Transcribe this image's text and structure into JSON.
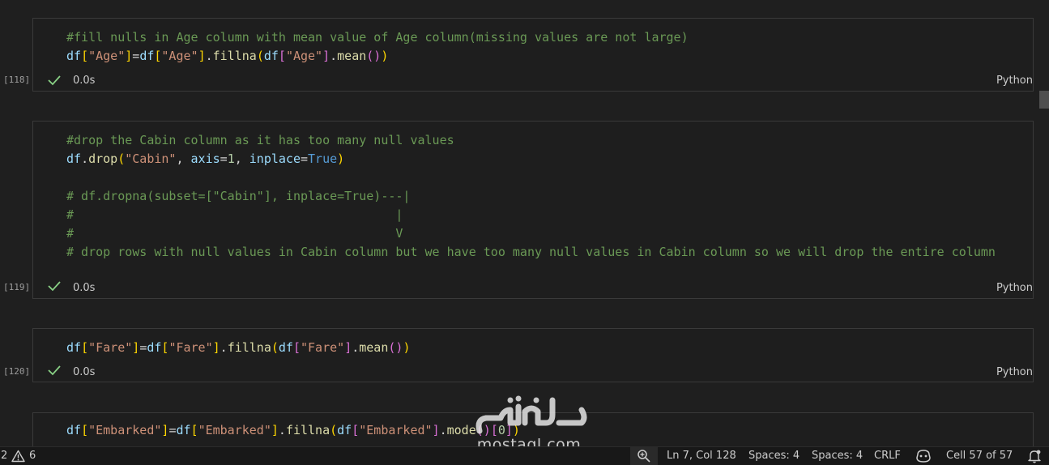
{
  "cells": [
    {
      "exec_count": "[118]",
      "status": "0.0s",
      "language": "Python",
      "lines": [
        [
          {
            "t": "#fill nulls in Age column with mean value of Age column(missing values are not large)",
            "c": "com"
          }
        ],
        [
          {
            "t": "df",
            "c": "var"
          },
          {
            "t": "[",
            "c": "br1"
          },
          {
            "t": "\"Age\"",
            "c": "str"
          },
          {
            "t": "]",
            "c": "br1"
          },
          {
            "t": "=",
            "c": "op"
          },
          {
            "t": "df",
            "c": "var"
          },
          {
            "t": "[",
            "c": "br1"
          },
          {
            "t": "\"Age\"",
            "c": "str"
          },
          {
            "t": "]",
            "c": "br1"
          },
          {
            "t": ".",
            "c": "op"
          },
          {
            "t": "fillna",
            "c": "fn"
          },
          {
            "t": "(",
            "c": "br1"
          },
          {
            "t": "df",
            "c": "var"
          },
          {
            "t": "[",
            "c": "br2"
          },
          {
            "t": "\"Age\"",
            "c": "str"
          },
          {
            "t": "]",
            "c": "br2"
          },
          {
            "t": ".",
            "c": "op"
          },
          {
            "t": "mean",
            "c": "fn"
          },
          {
            "t": "()",
            "c": "br2"
          },
          {
            "t": ")",
            "c": "br1"
          }
        ]
      ]
    },
    {
      "exec_count": "[119]",
      "status": "0.0s",
      "language": "Python",
      "lines": [
        [
          {
            "t": "#drop the Cabin column as it has too many null values",
            "c": "com"
          }
        ],
        [
          {
            "t": "df",
            "c": "var"
          },
          {
            "t": ".",
            "c": "op"
          },
          {
            "t": "drop",
            "c": "fn"
          },
          {
            "t": "(",
            "c": "br1"
          },
          {
            "t": "\"Cabin\"",
            "c": "str"
          },
          {
            "t": ", ",
            "c": "op"
          },
          {
            "t": "axis",
            "c": "var"
          },
          {
            "t": "=",
            "c": "op"
          },
          {
            "t": "1",
            "c": "num"
          },
          {
            "t": ", ",
            "c": "op"
          },
          {
            "t": "inplace",
            "c": "var"
          },
          {
            "t": "=",
            "c": "op"
          },
          {
            "t": "True",
            "c": "kw"
          },
          {
            "t": ")",
            "c": "br1"
          }
        ],
        [],
        [
          {
            "t": "# df.dropna(subset=[\"Cabin\"], inplace=True)---|",
            "c": "com"
          }
        ],
        [
          {
            "t": "#                                            |",
            "c": "com"
          }
        ],
        [
          {
            "t": "#                                            V",
            "c": "com"
          }
        ],
        [
          {
            "t": "# drop rows with null values in Cabin column but we have too many null values in Cabin column so we will drop the entire column",
            "c": "com"
          }
        ]
      ]
    },
    {
      "exec_count": "[120]",
      "status": "0.0s",
      "language": "Python",
      "lines": [
        [
          {
            "t": "df",
            "c": "var"
          },
          {
            "t": "[",
            "c": "br1"
          },
          {
            "t": "\"Fare\"",
            "c": "str"
          },
          {
            "t": "]",
            "c": "br1"
          },
          {
            "t": "=",
            "c": "op"
          },
          {
            "t": "df",
            "c": "var"
          },
          {
            "t": "[",
            "c": "br1"
          },
          {
            "t": "\"Fare\"",
            "c": "str"
          },
          {
            "t": "]",
            "c": "br1"
          },
          {
            "t": ".",
            "c": "op"
          },
          {
            "t": "fillna",
            "c": "fn"
          },
          {
            "t": "(",
            "c": "br1"
          },
          {
            "t": "df",
            "c": "var"
          },
          {
            "t": "[",
            "c": "br2"
          },
          {
            "t": "\"Fare\"",
            "c": "str"
          },
          {
            "t": "]",
            "c": "br2"
          },
          {
            "t": ".",
            "c": "op"
          },
          {
            "t": "mean",
            "c": "fn"
          },
          {
            "t": "()",
            "c": "br2"
          },
          {
            "t": ")",
            "c": "br1"
          }
        ]
      ]
    },
    {
      "exec_count": "",
      "status": "",
      "language": "",
      "lines": [
        [
          {
            "t": "df",
            "c": "var"
          },
          {
            "t": "[",
            "c": "br1"
          },
          {
            "t": "\"Embarked\"",
            "c": "str"
          },
          {
            "t": "]",
            "c": "br1"
          },
          {
            "t": "=",
            "c": "op"
          },
          {
            "t": "df",
            "c": "var"
          },
          {
            "t": "[",
            "c": "br1"
          },
          {
            "t": "\"Embarked\"",
            "c": "str"
          },
          {
            "t": "]",
            "c": "br1"
          },
          {
            "t": ".",
            "c": "op"
          },
          {
            "t": "fillna",
            "c": "fn"
          },
          {
            "t": "(",
            "c": "br1"
          },
          {
            "t": "df",
            "c": "var"
          },
          {
            "t": "[",
            "c": "br2"
          },
          {
            "t": "\"Embarked\"",
            "c": "str"
          },
          {
            "t": "]",
            "c": "br2"
          },
          {
            "t": ".",
            "c": "op"
          },
          {
            "t": "mode",
            "c": "fn"
          },
          {
            "t": "()",
            "c": "br2"
          },
          {
            "t": "[",
            "c": "br2"
          },
          {
            "t": "0",
            "c": "num"
          },
          {
            "t": "]",
            "c": "br2"
          },
          {
            "t": ")",
            "c": "br1"
          }
        ]
      ]
    }
  ],
  "statusbar": {
    "errors": "2",
    "warnings": "6",
    "cursor": "Ln 7, Col 128",
    "spaces1": "Spaces: 4",
    "spaces2": "Spaces: 4",
    "eol": "CRLF",
    "cell_pos": "Cell 57 of 57"
  },
  "watermark": {
    "arabic": "مستقل",
    "domain": "mostaql.com"
  },
  "icons": {
    "check": "check-icon",
    "warning": "warning-icon",
    "zoom": "zoom-icon",
    "copilot": "copilot-icon",
    "bell": "bell-icon"
  },
  "colors": {
    "check": "#89d185",
    "comment": "#6a9955",
    "string": "#ce9178",
    "function": "#dcdcaa",
    "variable": "#9cdcfe",
    "keyword": "#569cd6"
  }
}
